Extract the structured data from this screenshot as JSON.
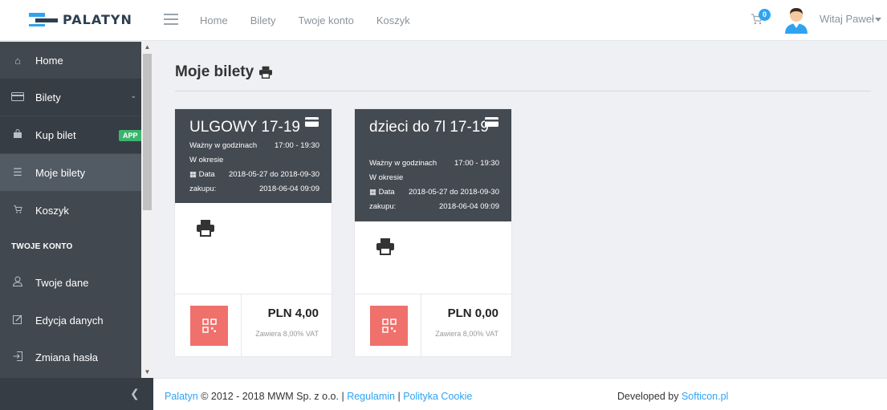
{
  "brand": {
    "name": "PALATYN"
  },
  "topnav": {
    "items": [
      "Home",
      "Bilety",
      "Twoje konto",
      "Koszyk"
    ]
  },
  "header": {
    "cart_count": "0",
    "greeting": "Witaj Paweł"
  },
  "sidebar": {
    "items": [
      {
        "label": "Home",
        "icon": "home-icon"
      },
      {
        "label": "Bilety",
        "icon": "ticket-icon"
      },
      {
        "label": "Kup bilet",
        "icon": "bag-icon",
        "badge": "APP"
      },
      {
        "label": "Moje bilety",
        "icon": "list-icon"
      },
      {
        "label": "Koszyk",
        "icon": "cart-icon"
      }
    ],
    "section_label": "TWOJE KONTO",
    "account_items": [
      {
        "label": "Twoje dane",
        "icon": "user-icon"
      },
      {
        "label": "Edycja danych",
        "icon": "edit-icon"
      },
      {
        "label": "Zmiana hasła",
        "icon": "login-icon"
      }
    ]
  },
  "main": {
    "title": "Moje bilety",
    "tickets": [
      {
        "name": "ULGOWY 17-19",
        "valid_label": "Ważny w godzinach",
        "hours": "17:00 - 19:30",
        "period_label": "W okresie",
        "date_label": "Data",
        "period": "2018-05-27 do 2018-09-30",
        "purchase_label": "zakupu:",
        "purchased": "2018-06-04 09:09",
        "price": "PLN 4,00",
        "vat": "Zawiera 8,00% VAT"
      },
      {
        "name": "dzieci do 7l 17-19",
        "valid_label": "Ważny w godzinach",
        "hours": "17:00 - 19:30",
        "period_label": "W okresie",
        "date_label": "Data",
        "period": "2018-05-27 do 2018-09-30",
        "purchase_label": "zakupu:",
        "purchased": "2018-06-04 09:09",
        "price": "PLN 0,00",
        "vat": "Zawiera 8,00% VAT"
      }
    ]
  },
  "footer": {
    "brand_link": "Palatyn",
    "copyright": "© 2012 - 2018 MWM Sp. z o.o.",
    "sep": "|",
    "regulamin": "Regulamin",
    "cookie": "Polityka Cookie",
    "developed_by": "Developed by",
    "dev_link": "Softicon.pl"
  },
  "colors": {
    "accent": "#2ea3f2",
    "sidebar": "#414850",
    "card_head": "#444a52",
    "qr": "#f0706c",
    "badge_green": "#3cb46e"
  }
}
